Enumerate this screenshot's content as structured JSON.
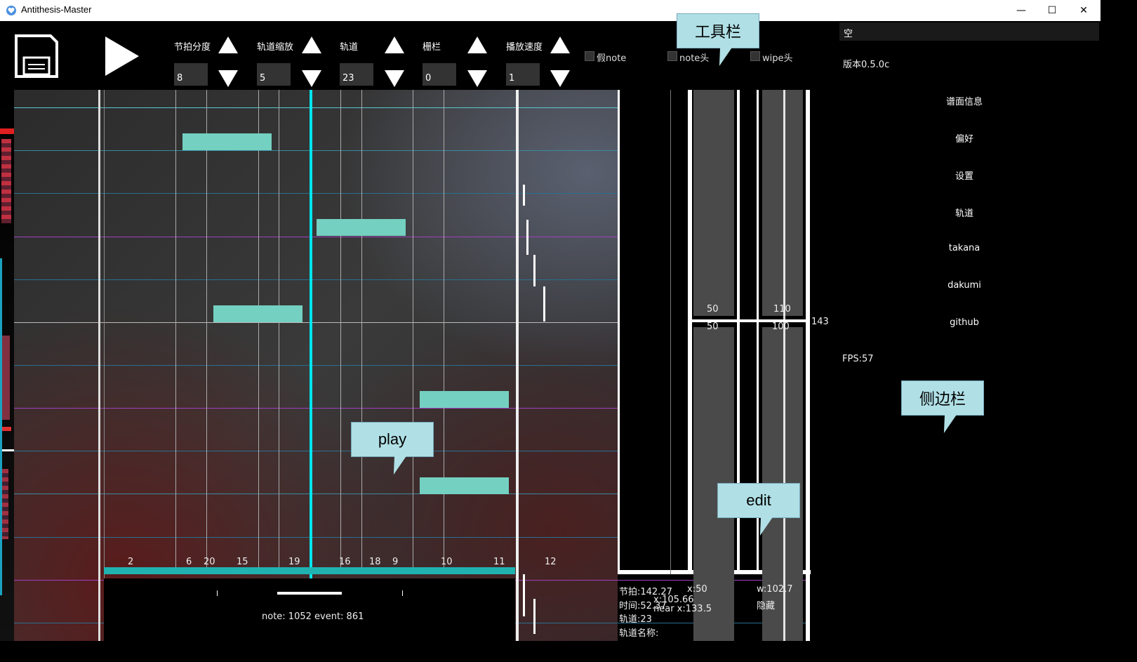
{
  "window": {
    "title": "Antithesis-Master",
    "minimize": "—",
    "maximize": "☐",
    "close": "✕"
  },
  "toolbar": {
    "beat_division": {
      "label": "节拍分度",
      "value": "8"
    },
    "track_zoom": {
      "label": "轨道缩放",
      "value": "5"
    },
    "track": {
      "label": "轨道",
      "value": "23"
    },
    "grid": {
      "label": "栅栏",
      "value": "0"
    },
    "play_speed": {
      "label": "播放速度",
      "value": "1"
    },
    "checkboxes": [
      {
        "label": "假note",
        "checked": false
      },
      {
        "label": "note头",
        "checked": false
      },
      {
        "label": "wipe头",
        "checked": false
      }
    ]
  },
  "callouts": {
    "toolbar": "工具栏",
    "sidebar": "侧边栏",
    "play": "play",
    "edit": "edit"
  },
  "sidebar": {
    "search_value": "空",
    "version": "版本0.5.0c",
    "items": [
      "谱面信息",
      "偏好",
      "设置",
      "轨道",
      "takana",
      "dakumi",
      "github"
    ],
    "fps": "FPS:57"
  },
  "editor": {
    "timeline_ticks": [
      "2",
      "6",
      "20",
      "15",
      "19",
      "16",
      "18",
      "9",
      "10",
      "11",
      "12"
    ],
    "counts": "note: 1052  event: 861",
    "track_values": {
      "top_left": "50",
      "top_right": "110",
      "bottom_left": "50",
      "bottom_right": "100",
      "side": "143"
    },
    "info": {
      "beat": "节拍:142.27",
      "time": "时间:52.37",
      "track": "轨道:23",
      "track_name": "轨道名称:",
      "x": "x:50",
      "x2": "x:105.66",
      "near": "near x:133.5",
      "w": "w:102.7",
      "hidden": "隐藏"
    }
  },
  "colors": {
    "accent": "#00e5ee",
    "note": "#74d0c0",
    "callout": "#b0e0e6",
    "purple_line": "#a040c0"
  }
}
